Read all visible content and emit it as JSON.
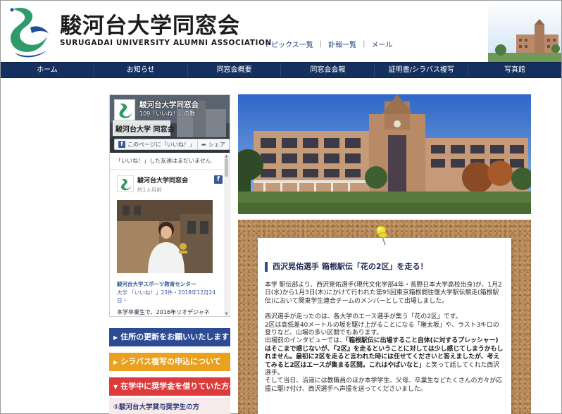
{
  "header": {
    "logo_jp": "駿河台大学同窓会",
    "logo_en": "SURUGADAI UNIVERSITY ALUMNI ASSOCIATION",
    "links": [
      "トピックス一覧",
      "訃報一覧",
      "メール"
    ],
    "link_separator": "|"
  },
  "nav": {
    "items": [
      "ホーム",
      "お知らせ",
      "同窓会概要",
      "同窓会会報",
      "証明書/シラバス複写",
      "写真館"
    ]
  },
  "facebook": {
    "page_name": "駿河台大学同窓会",
    "likes": "109「いいね！」の数",
    "like_button": "このページに「いいね！」",
    "share_button": "シェア",
    "friends_text": "「いいね！」した友達はまだいません",
    "post": {
      "author": "駿河台大学同窓会",
      "time": "約1ヵ月前",
      "link_name": "駿河台大学スポーツ教育センター",
      "meta": "大学 「いいね！」23件・2018年12月24日・",
      "text": "本学卒業生で、2016年リオデジャネ"
    },
    "cover_name": "駿河台大学 同窓会"
  },
  "sidebar": {
    "banners": [
      {
        "label": "住所の更新をお願いいたします",
        "color": "#2d4b95"
      },
      {
        "label": "シラバス複写の申込について",
        "color": "#e9a11f"
      },
      {
        "label": "在学中に奨学金を借りていた方へ",
        "color": "#dc3a3b"
      }
    ],
    "loan_sub": "①駿河台大学貸与奨学生の方"
  },
  "article": {
    "title": "西沢晃佑選手 箱根駅伝「花の2区」を走る！",
    "p1": "本学 駅伝部より、西沢晃佑選手(現代文化学部4年・長野日本大学高校出身)が、1月2日(水)から1月3日(木)にかけて行われた第95回東京箱根間往復大学駅伝競走(箱根駅伝)において関東学生連合チームのメンバーとして出場しました。",
    "p2": "西沢選手が走ったのは、各大学のエース選手が集う「花の2区」です。",
    "p3": "2区は高低差40メートルの坂を駆け上がることになる「権太坂」や、ラスト3キロの登りなど、山場の多い区間でもあります。",
    "p4_lead": "出場前のインタビューでは、",
    "p4_bold": "「箱根駅伝に出場すること自体(に対するプレッシャー)はそこまで感じないが、『2区』を走るということに対しては少し感じてしまうかもしれません。最初に2区を走ると言われた時には任せてくださいと答えましたが、考えてみると2区はエースが集まる区間。これはやばいなと」",
    "p4_tail": "と笑って話してくれた西沢選手。",
    "p5": "そして当日、沿道には教職員のほか本学学生、父母、卒業生などたくさんの方々が応援に駆け付け、西沢選手へ声援を送ってくださいました。"
  },
  "colors": {
    "nav_bg": "#15305f",
    "accent_blue": "#2d4b95",
    "accent_orange": "#e9a11f",
    "accent_red": "#dc3a3b",
    "logo_green": "#2f9a6a",
    "logo_blue": "#1f4e9c"
  }
}
